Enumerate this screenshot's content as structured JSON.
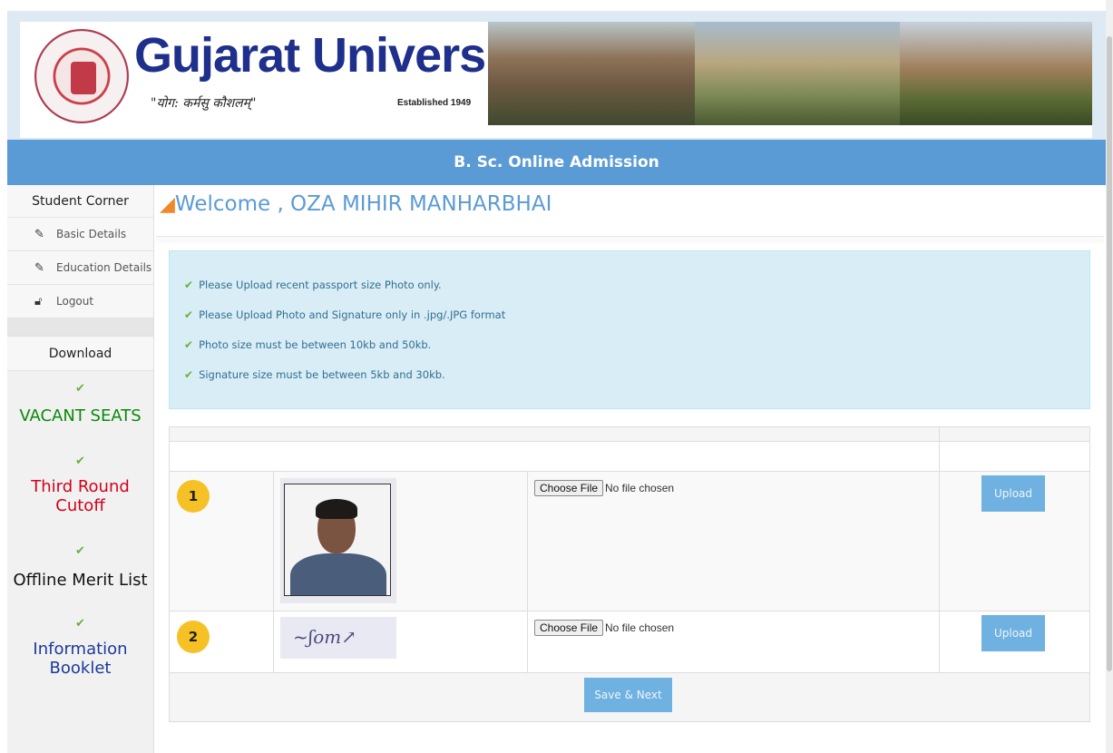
{
  "header": {
    "university_name": "Gujarat University",
    "motto": "\"योग: कर्मसु कौशलम्\"",
    "established": "Established 1949"
  },
  "title_bar": {
    "title": "B. Sc. Online Admission"
  },
  "sidebar": {
    "heading": "Student Corner",
    "items": [
      {
        "label": "Basic Details",
        "icon": "pencil-icon"
      },
      {
        "label": "Education Details",
        "icon": "pencil-icon"
      },
      {
        "label": "Logout",
        "icon": "unlock-icon"
      }
    ],
    "download_heading": "Download",
    "downloads": [
      {
        "label": "VACANT SEATS",
        "color": "#0a8a0a"
      },
      {
        "label": "Third Round Cutoff",
        "color": "#d0021b"
      },
      {
        "label": "Offline Merit List",
        "color": "#111111"
      },
      {
        "label": "Information Booklet",
        "color": "#1a3a9a"
      }
    ]
  },
  "main": {
    "welcome": "Welcome , OZA MIHIR MANHARBHAI",
    "instructions": [
      "Please Upload recent passport size Photo only.",
      "Please Upload Photo and Signature only in .jpg/.JPG format",
      "Photo size must be between 10kb and 50kb.",
      "Signature size must be between 5kb and 30kb."
    ],
    "uploads": [
      {
        "number": "1",
        "choose_label": "Choose File",
        "file_status": "No file chosen",
        "upload_label": "Upload"
      },
      {
        "number": "2",
        "choose_label": "Choose File",
        "file_status": "No file chosen",
        "upload_label": "Upload"
      }
    ],
    "save_label": "Save & Next"
  },
  "colors": {
    "title_bar": "#5b9bd5",
    "info_bg": "#d9edf7",
    "badge": "#f5c124",
    "button": "#6fb1e0"
  }
}
